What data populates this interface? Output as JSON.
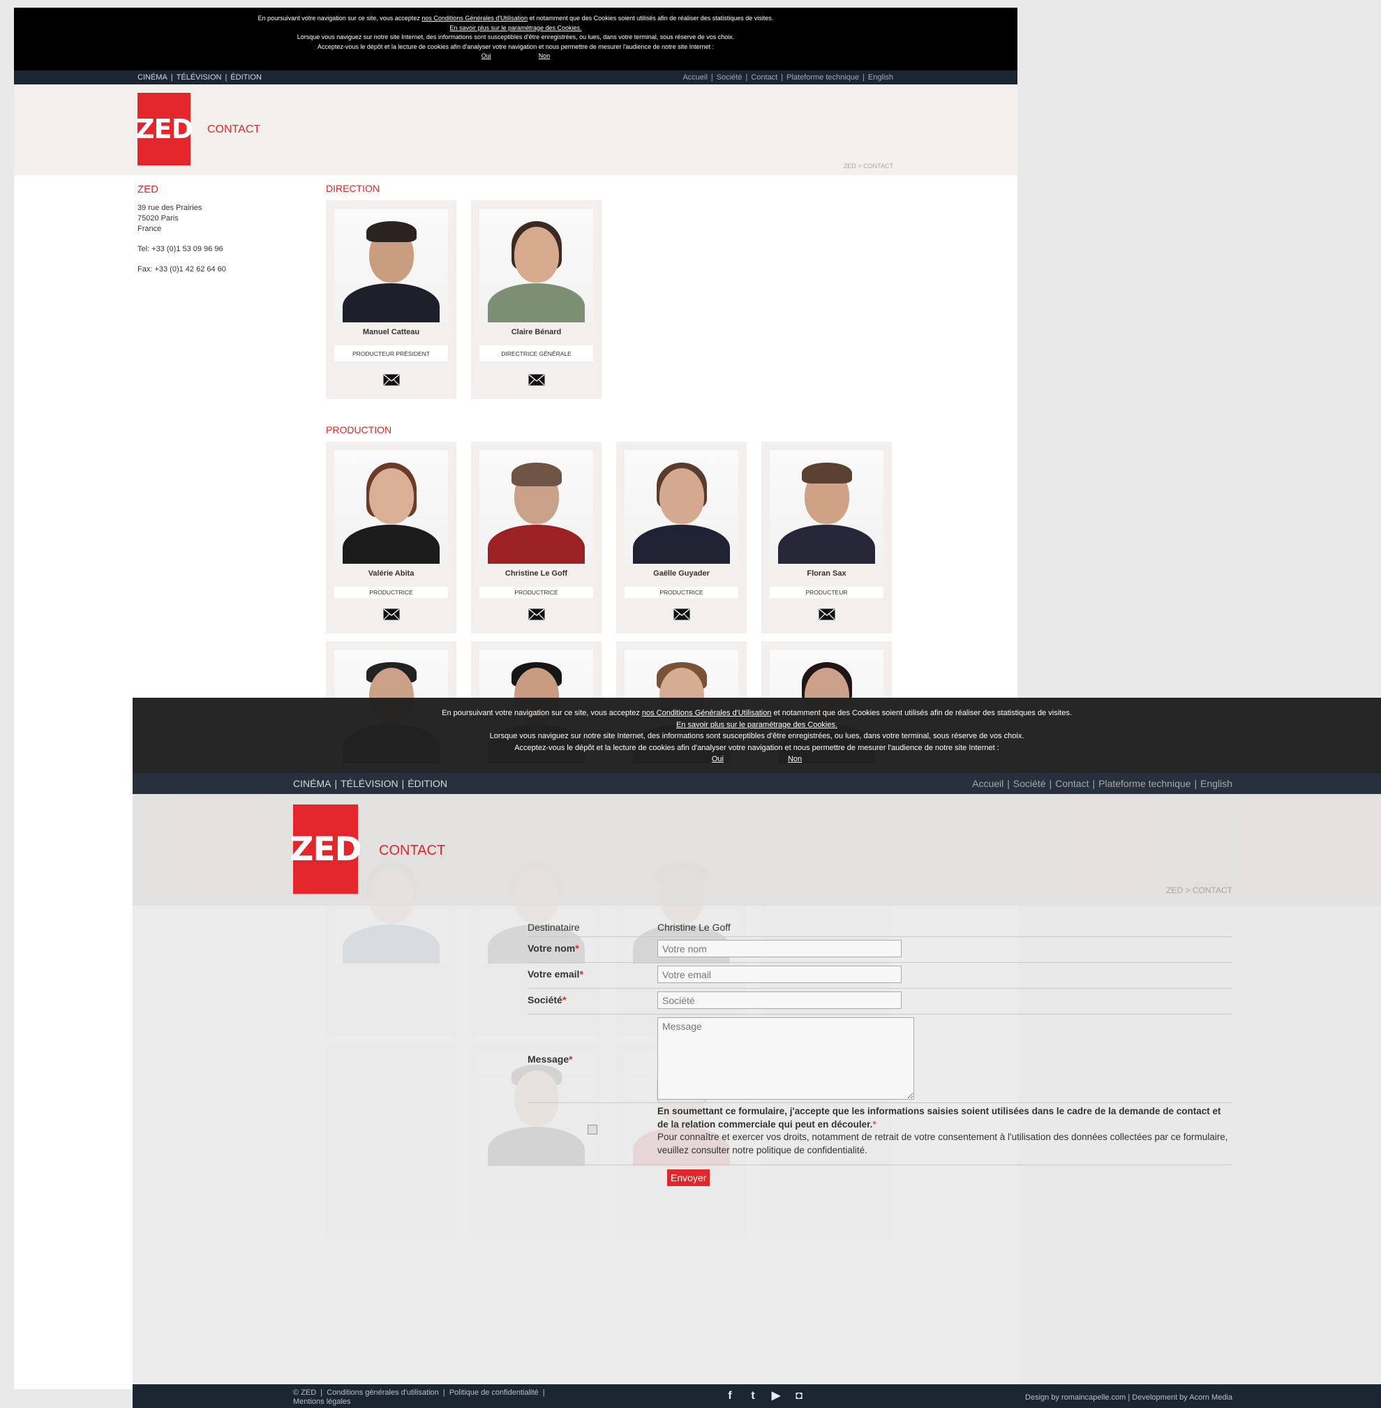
{
  "cookie": {
    "line1_pre": "En poursuivant votre navigation sur ce site, vous acceptez ",
    "line1_link": "nos Conditions Générales d'Utilisation",
    "line1_post": " et notamment que des Cookies soient utilisés afin de réaliser des statistiques de visites.",
    "line2": "En savoir plus sur le paramétrage des Cookies.",
    "line3": "Lorsque vous naviguez sur notre site Internet, des informations sont susceptibles d'être enregistrées, ou lues, dans votre terminal, sous réserve de vos choix.",
    "line4": "Acceptez-vous le dépôt et la lecture de cookies afin d'analyser votre navigation et nous permettre de mesurer l'audience de notre site Internet :",
    "yes": "Oui",
    "no": "Non"
  },
  "nav": {
    "left": [
      "CINÉMA",
      "TÉLÉVISION",
      "ÉDITION"
    ],
    "right": [
      "Accueil",
      "Société",
      "Contact",
      "Plateforme technique",
      "English"
    ]
  },
  "header": {
    "logo": "ZED",
    "title": "CONTACT",
    "breadcrumb": "ZED > CONTACT"
  },
  "company": {
    "name": "ZED",
    "address1": "39 rue des Prairies",
    "address2": "75020 Paris",
    "address3": "France",
    "tel": "Tel: +33 (0)1 53 09 96 96",
    "fax": "Fax: +33 (0)1 42 62 64 60"
  },
  "sections": {
    "direction": "DIRECTION",
    "production": "PRODUCTION"
  },
  "direction": [
    {
      "name": "Manuel Catteau",
      "role": "PRODUCTEUR PRÉSIDENT"
    },
    {
      "name": "Claire Bénard",
      "role": "DIRECTRICE GÉNÉRALE"
    }
  ],
  "production": [
    {
      "name": "Valérie Abita",
      "role": "PRODUCTRICE"
    },
    {
      "name": "Christine Le Goff",
      "role": "PRODUCTRICE"
    },
    {
      "name": "Gaëlle Guyader",
      "role": "PRODUCTRICE"
    },
    {
      "name": "Floran Sax",
      "role": "PRODUCTEUR"
    }
  ],
  "form": {
    "recipient_label": "Destinataire",
    "recipient_value": "Christine Le Goff",
    "name_label": "Votre nom",
    "name_placeholder": "Votre nom",
    "email_label": "Votre email",
    "email_placeholder": "Votre email",
    "company_label": "Société",
    "company_placeholder": "Société",
    "message_label": "Message",
    "message_placeholder": "Message",
    "required_mark": "*",
    "consent_bold": "En soumettant ce formulaire, j'accepte que les informations saisies soient utilisées dans le cadre de la demande de contact et de la relation commerciale qui peut en découler.",
    "consent_text": "Pour connaître et exercer vos droits, notamment de retrait de votre consentement à l'utilisation des données collectées par ce formulaire, veuillez consulter notre politique de confidentialité.",
    "submit": "Envoyer"
  },
  "footer": {
    "copyright": "© ZED",
    "cgu": "Conditions générales d'utilisation",
    "privacy": "Politique de confidentialité",
    "legal": "Mentions légales",
    "credits": "Design by romaincapelle.com  |  Development by Acorn Media"
  },
  "colors": {
    "brand_red": "#e3262b",
    "nav_dark": "#1c2633",
    "panel_beige": "#f2efed"
  }
}
